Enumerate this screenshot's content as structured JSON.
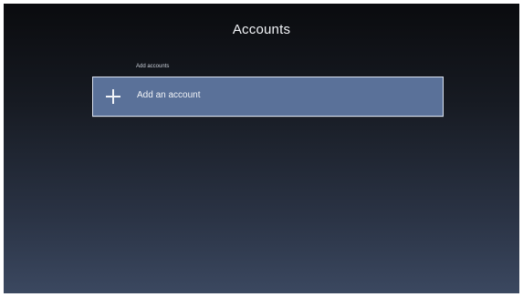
{
  "page": {
    "title": "Accounts"
  },
  "accounts": {
    "section_label": "Add accounts",
    "add_item_label": "Add an account",
    "add_item_icon": "plus-icon"
  },
  "colors": {
    "background_top": "#0a0b0e",
    "background_bottom": "#3b4860",
    "selected_item": "#5a7199",
    "text": "#f2f4f8"
  }
}
